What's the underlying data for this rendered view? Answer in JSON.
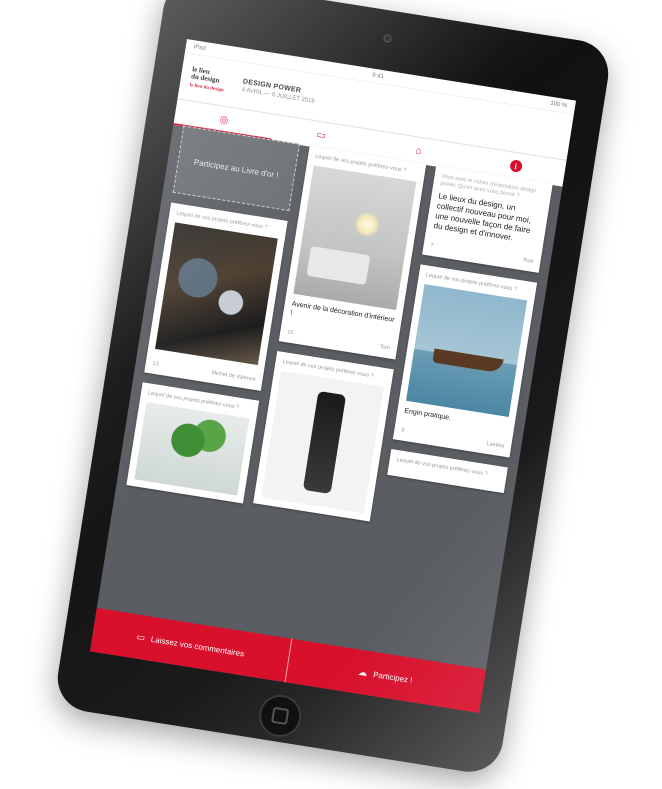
{
  "status_bar": {
    "carrier": "iPad",
    "time": "9:41",
    "battery": "100 %"
  },
  "header": {
    "logo_line1": "le lieu",
    "logo_line2": "du design",
    "logo_line3": "le lieu du design",
    "title": "DESIGN POWER",
    "dates": "4 AVRIL — 6 JUILLET 2016"
  },
  "tabs": [
    {
      "icon": "lightbulb-icon",
      "glyph": "◎"
    },
    {
      "icon": "screen-icon",
      "glyph": "▭"
    },
    {
      "icon": "home-icon",
      "glyph": "⌂"
    },
    {
      "icon": "info-icon",
      "glyph": "i"
    }
  ],
  "participate_box": "Participez au Livre d'or !",
  "cards": {
    "tools": {
      "question": "Lequel de vos projets préférez-vous ?",
      "likes": "12",
      "author": "Michel de Valence"
    },
    "lamp": {
      "question": "Lequel de vos projets préférez-vous ?",
      "caption": "Avenir de la décoration d'intérieur !",
      "likes": "15",
      "author": "Tom"
    },
    "quote": {
      "question": "Vous avez le cahier d'exposition design power. Qu'en avez-vous pensé ?",
      "text": "Le lieux du design, un collectif nouveau pour moi, une nouvelle façon de faire du design et d'innover.",
      "likes": "7",
      "author": "Rob"
    },
    "boat": {
      "question": "Lequel de vos projets préférez-vous ?",
      "caption": "Engin pratique.",
      "likes": "9",
      "author": "Laetitia"
    },
    "plant": {
      "question": "Lequel de vos projets préférez-vous ?"
    },
    "robot": {
      "question": "Lequel de vos projets préférez-vous ?"
    },
    "last": {
      "question": "Lequel de vos projets préférez-vous ?"
    }
  },
  "bottom_bar": {
    "left_label": "Laissez vos commentaires",
    "right_label": "Participez !"
  },
  "colors": {
    "accent": "#d8102c",
    "board": "#5a5d62"
  }
}
